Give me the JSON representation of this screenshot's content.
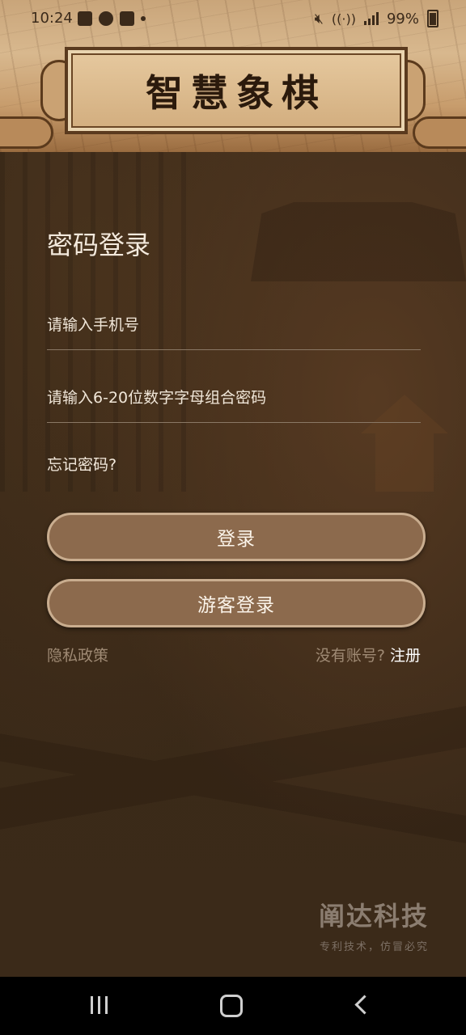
{
  "status_bar": {
    "time": "10:24",
    "battery": "99%",
    "icons": [
      "gallery-icon",
      "chat-icon",
      "checkbox-icon",
      "dot-icon",
      "mute-icon",
      "wifi-icon",
      "signal-icon",
      "battery-icon"
    ]
  },
  "header": {
    "title": "智慧象棋"
  },
  "login": {
    "title": "密码登录",
    "phone_placeholder": "请输入手机号",
    "password_placeholder": "请输入6-20位数字字母组合密码",
    "forgot": "忘记密码?",
    "login_button": "登录",
    "guest_button": "游客登录",
    "privacy": "隐私政策",
    "no_account": "没有账号?",
    "register": "注册"
  },
  "watermark": {
    "brand": "阐达科技",
    "slogan": "专利技术，仿冒必究"
  },
  "colors": {
    "background": "#3a2918",
    "button": "#8c6a4d",
    "button_border": "#c9ad8f",
    "header": "#d2ad7e"
  },
  "nav_bar": {
    "icons": [
      "recent-apps-icon",
      "home-icon",
      "back-icon"
    ]
  }
}
